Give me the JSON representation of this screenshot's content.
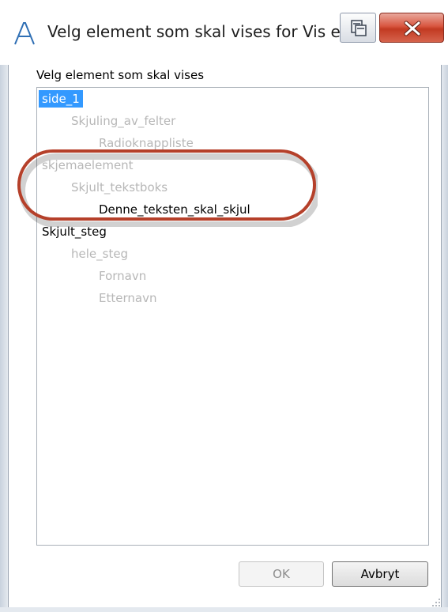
{
  "window": {
    "title": "Velg element som skal vises for Vis elem..."
  },
  "list": {
    "label": "Velg element som skal vises"
  },
  "tree_items": [
    {
      "text": "side_1",
      "state": "selected"
    },
    {
      "text": "Skjuling_av_felter",
      "state": "disabled"
    },
    {
      "text": "Radioknappliste",
      "state": "disabled"
    },
    {
      "text": "skjemaelement",
      "state": "disabled"
    },
    {
      "text": "Skjult_tekstboks",
      "state": "disabled"
    },
    {
      "text": "Denne_teksten_skal_skjul",
      "state": "enabled"
    },
    {
      "text": "Skjult_steg",
      "state": "enabled"
    },
    {
      "text": "hele_steg",
      "state": "disabled"
    },
    {
      "text": "Fornavn",
      "state": "disabled"
    },
    {
      "text": "Etternavn",
      "state": "disabled"
    }
  ],
  "buttons": {
    "ok": "OK",
    "cancel": "Avbryt"
  },
  "colors": {
    "selection": "#3399ff",
    "annotation_circle": "#b5402a",
    "disabled_text": "#b7b7b7"
  },
  "icons": {
    "app": "app-a-icon",
    "pin": "restore-window-icon",
    "close": "close-icon",
    "grip": "resize-grip-icon"
  }
}
